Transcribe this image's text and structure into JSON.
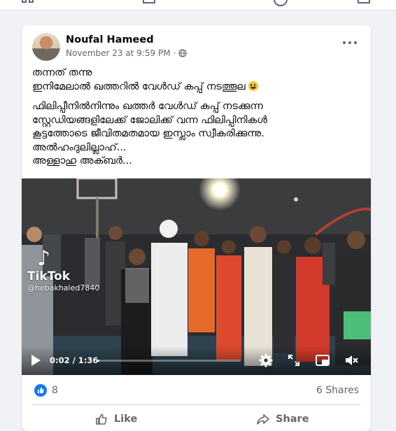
{
  "post": {
    "author": "Noufal Hameed",
    "timestamp": "November 23 at 9:59 PM",
    "separator": "·",
    "text_lines_1": [
      "തന്നത് തന്നു",
      "ഇനിമേലാൽ ഖത്തറിൽ വേൾഡ് കപ്പ് നടത്തൂല"
    ],
    "text_lines_2": [
      "ഫിലിപ്പീനിൽനിന്നും ഖത്തർ വേൾഡ് കപ്പ് നടക്കുന്ന",
      "സ്റ്റേഡിയങ്ങളിലേക്ക് ജോലിക്ക് വന്ന ഫിലിപ്പിനികൾ",
      "കൂട്ടത്തോടെ ജീവിതമതമായ ഇസ്ലാം സ്വീകരിക്കുന്നു.",
      "അൽഹംദുലില്ലാഹ്...",
      "അള്ളാഹു അക്ബർ..."
    ]
  },
  "video": {
    "watermark_logo": "♪",
    "watermark_name": "TikTok",
    "watermark_handle": "@hebakhaled7840",
    "time_display": "0:02 / 1:36",
    "progress": 0.021
  },
  "stats": {
    "reactions": "8",
    "shares": "6 Shares"
  },
  "actions": {
    "like": "Like",
    "share": "Share"
  },
  "icons": [
    "globe-icon",
    "more-options-icon",
    "play-icon",
    "settings-icon",
    "fullscreen-icon",
    "picture-in-picture-icon",
    "volume-icon",
    "like-reaction-icon",
    "thumbs-up-icon",
    "share-icon"
  ],
  "colors": {
    "accent": "#1877f2",
    "secondary_text": "#65676b",
    "background": "#f0f2f5"
  }
}
